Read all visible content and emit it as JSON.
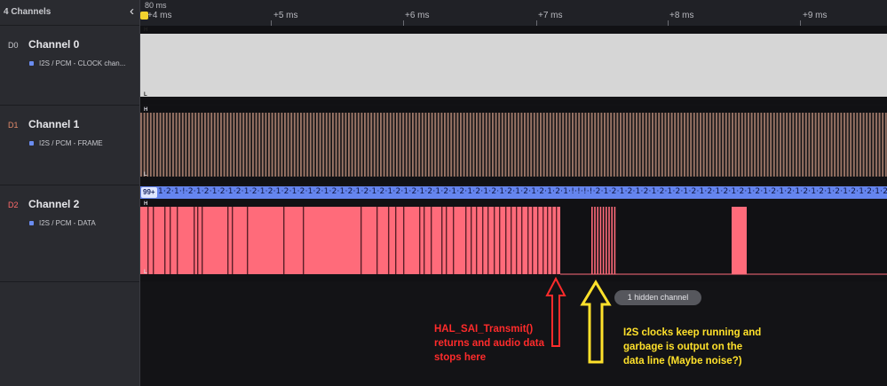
{
  "sidebar": {
    "title": "4 Channels",
    "collapse_icon": "chevron-left-icon",
    "channels": [
      {
        "id": "D0",
        "id_color": "#c8c9ce",
        "name": "Channel 0",
        "analyzer": "I2S / PCM - CLOCK chan..."
      },
      {
        "id": "D1",
        "id_color": "#e08a6a",
        "name": "Channel 1",
        "analyzer": "I2S / PCM - FRAME"
      },
      {
        "id": "D2",
        "id_color": "#ff6b6b",
        "name": "Channel 2",
        "analyzer": "I2S / PCM - DATA"
      }
    ]
  },
  "ruler": {
    "offset": "80 ms",
    "ticks": [
      "+4 ms",
      "+5 ms",
      "+6 ms",
      "+7 ms",
      "+8 ms",
      "+9 ms"
    ]
  },
  "waveform": {
    "high_label": "H",
    "low_label": "L",
    "ch0_color": "#d6d6d6",
    "ch1_color": "#9a7566",
    "ch2_color": "#ff6b7a",
    "decoder_color": "#6585ef"
  },
  "decoder": {
    "badge": "99+",
    "text": "1·2·1·!·2·1·2·1·2·1·2·1·2·1·2·1·2·1·2·1·2·1·2·1·2·1·2·1·2·1·2·1·2·1·2·1·2·1·2·1·2·1·2·1·2·1·2·1·2·1·2·1·!·!·!·!·2·1·2·1·2·1·2·1·2·1·2·1·2·1·2·1·2·1·2·1·2·1·2·1·2·1·2·1·2·1·2·1·2·1·2·1·2·1·2·1·2·1·2·1·2"
  },
  "hidden_channels": "1 hidden channel",
  "annotations": {
    "red": [
      "HAL_SAI_Transmit()",
      "returns and audio data",
      "stops here"
    ],
    "yellow": [
      "I2S clocks keep running and",
      "garbage is output on the",
      "data line (Maybe noise?)"
    ],
    "red_color": "#ff2b2b",
    "yellow_color": "#ffe12b"
  }
}
